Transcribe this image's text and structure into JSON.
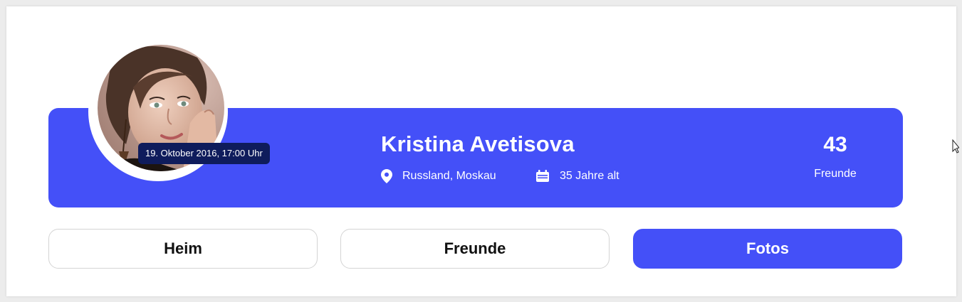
{
  "profile": {
    "name": "Kristina Avetisova",
    "location": "Russland, Moskau",
    "age": "35 Jahre alt",
    "avatar_date": "19. Oktober 2016, 17:00 Uhr"
  },
  "stats": {
    "friends_count": "43",
    "friends_label": "Freunde"
  },
  "tabs": [
    {
      "label": "Heim",
      "active": false
    },
    {
      "label": "Freunde",
      "active": false
    },
    {
      "label": "Fotos",
      "active": true
    }
  ],
  "icons": {
    "location": "map-pin-icon",
    "age": "calendar-icon"
  },
  "colors": {
    "accent": "#4450f8",
    "tooltip": "#0f1c5c",
    "background": "#ffffff"
  }
}
